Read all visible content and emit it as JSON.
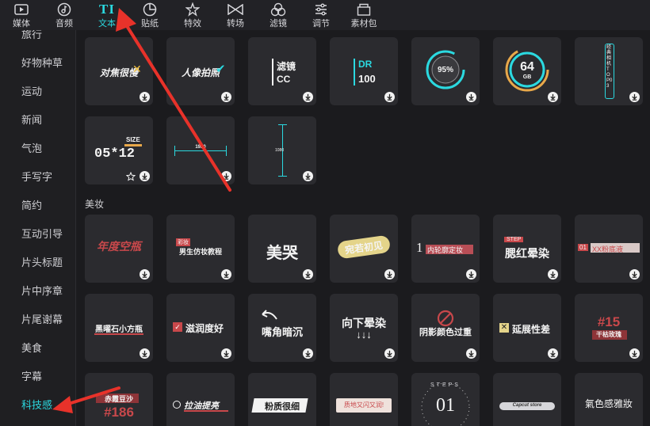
{
  "toolbar": {
    "items": [
      {
        "label": "媒体",
        "icon": "media-icon"
      },
      {
        "label": "音频",
        "icon": "audio-icon"
      },
      {
        "label": "文本",
        "icon": "text-icon"
      },
      {
        "label": "贴纸",
        "icon": "sticker-icon"
      },
      {
        "label": "特效",
        "icon": "effects-icon"
      },
      {
        "label": "转场",
        "icon": "transition-icon"
      },
      {
        "label": "滤镜",
        "icon": "filter-icon"
      },
      {
        "label": "调节",
        "icon": "adjust-icon"
      },
      {
        "label": "素材包",
        "icon": "package-icon"
      }
    ],
    "active_index": 2,
    "text_icon_glyph": "TI"
  },
  "sidebar": {
    "items": [
      "旅行",
      "好物种草",
      "运动",
      "新闻",
      "气泡",
      "手写字",
      "简约",
      "互动引导",
      "片头标题",
      "片中序章",
      "片尾谢幕",
      "美食",
      "字幕",
      "科技感"
    ],
    "active": "科技感"
  },
  "section": {
    "title": "美妆"
  },
  "tech_tiles": [
    {
      "text": "对焦很慢"
    },
    {
      "text": "人像拍照"
    },
    {
      "line1": "滤镜",
      "line2": "CC"
    },
    {
      "line1": "DR",
      "line2": "100"
    },
    {
      "text": "95%"
    },
    {
      "text": "64",
      "sub": "GB"
    },
    {
      "text": "经典相机 TOP03"
    },
    {
      "line1": "SIZE",
      "line2": "05*12"
    },
    {
      "text": "1920"
    },
    {
      "text": "1080"
    }
  ],
  "makeup_tiles": [
    {
      "text": "年度空瓶"
    },
    {
      "line1": "彩妆",
      "line2": "男生仿妆教程"
    },
    {
      "text": "美哭"
    },
    {
      "text": "宛若初见"
    },
    {
      "num": "1",
      "text": "内轮廓定妆"
    },
    {
      "line1": "STEP",
      "line2": "腮红晕染"
    },
    {
      "num": "01",
      "text": "XX粉底液"
    },
    {
      "text": "黑曜石小方瓶"
    },
    {
      "text": "滋润度好"
    },
    {
      "text": "嘴角暗沉"
    },
    {
      "line1": "向下晕染",
      "line2": "↓↓↓"
    },
    {
      "text": "阴影颜色过重"
    },
    {
      "text": "延展性差"
    },
    {
      "line1": "#15",
      "line2": "干枯玫瑰"
    },
    {
      "line1": "赤霞豆沙",
      "line2": "#186"
    },
    {
      "text": "拉油提亮"
    },
    {
      "text": "粉质很细"
    },
    {
      "text": "质地又闪又润!"
    },
    {
      "line1": "STEPS",
      "line2": "01"
    },
    {
      "text": "Capcut store"
    },
    {
      "text": "氣色感雅妝"
    }
  ],
  "colors": {
    "accent": "#2bd9e0",
    "annotation": "#e8322a",
    "tile_bg": "#2b2b2f",
    "makeup_red": "#c8484b"
  }
}
